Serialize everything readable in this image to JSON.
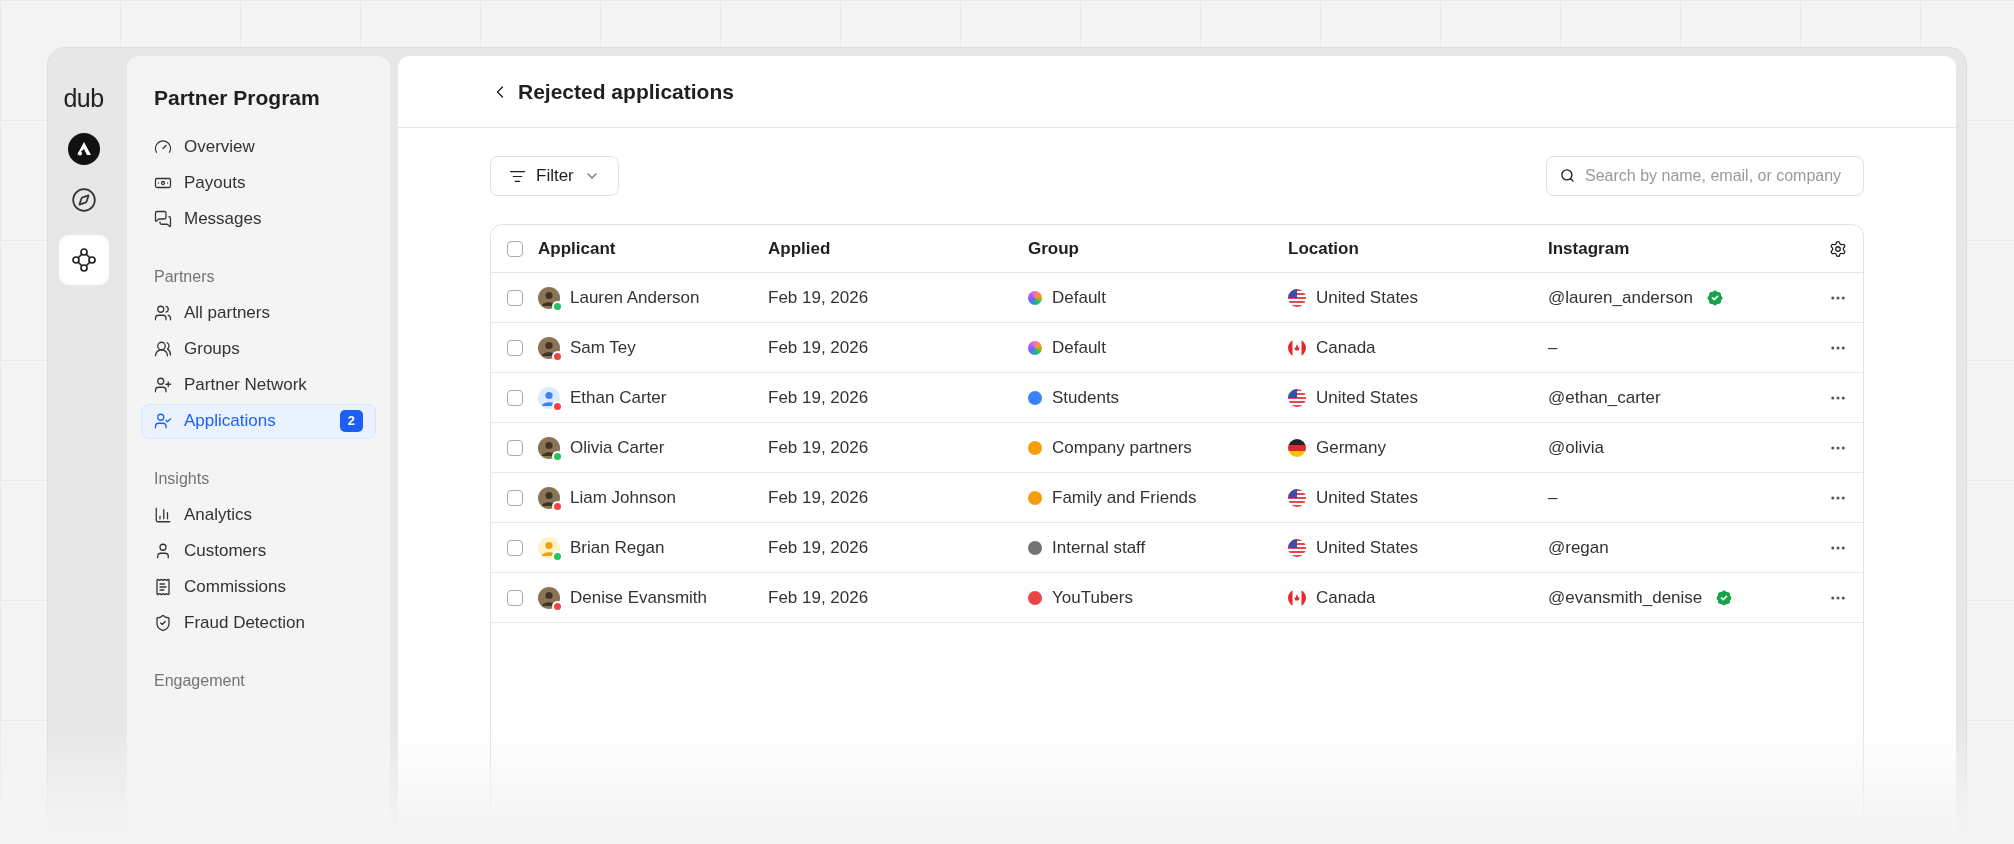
{
  "brand": "dub",
  "sidebar": {
    "title": "Partner Program",
    "sections": [
      {
        "items": [
          {
            "label": "Overview",
            "selected": false
          },
          {
            "label": "Payouts",
            "selected": false
          },
          {
            "label": "Messages",
            "selected": false
          }
        ]
      },
      {
        "heading": "Partners",
        "items": [
          {
            "label": "All partners",
            "selected": false
          },
          {
            "label": "Groups",
            "selected": false
          },
          {
            "label": "Partner Network",
            "selected": false
          },
          {
            "label": "Applications",
            "selected": true,
            "badge": "2"
          }
        ]
      },
      {
        "heading": "Insights",
        "items": [
          {
            "label": "Analytics",
            "selected": false
          },
          {
            "label": "Customers",
            "selected": false
          },
          {
            "label": "Commissions",
            "selected": false
          },
          {
            "label": "Fraud Detection",
            "selected": false
          }
        ]
      },
      {
        "heading": "Engagement"
      }
    ]
  },
  "page": {
    "title": "Rejected applications"
  },
  "filter": {
    "label": "Filter"
  },
  "search": {
    "placeholder": "Search by name, email, or company"
  },
  "table": {
    "all_checked": false,
    "columns": [
      "Applicant",
      "Applied",
      "Group",
      "Location",
      "Instagram"
    ],
    "rows": [
      {
        "checked": false,
        "name": "Lauren Anderson",
        "avatar": {
          "kind": "photo",
          "color": "#22c55e"
        },
        "applied": "Feb 19, 2026",
        "group": {
          "name": "Default",
          "kind": "gradient"
        },
        "location": {
          "name": "United States",
          "kind": "us"
        },
        "instagram": "@lauren_anderson",
        "verified": true
      },
      {
        "checked": false,
        "name": "Sam Tey",
        "avatar": {
          "kind": "photo",
          "color": "#ef4444"
        },
        "applied": "Feb 19, 2026",
        "group": {
          "name": "Default",
          "kind": "gradient"
        },
        "location": {
          "name": "Canada",
          "kind": "ca"
        },
        "instagram": "–",
        "verified": false
      },
      {
        "checked": false,
        "name": "Ethan Carter",
        "avatar": {
          "kind": "blue",
          "color": "#ef4444"
        },
        "applied": "Feb 19, 2026",
        "group": {
          "name": "Students",
          "kind": "solid",
          "color": "#3b82f6"
        },
        "location": {
          "name": "United States",
          "kind": "us"
        },
        "instagram": "@ethan_carter",
        "verified": false
      },
      {
        "checked": false,
        "name": "Olivia Carter",
        "avatar": {
          "kind": "photo",
          "color": "#22c55e"
        },
        "applied": "Feb 19, 2026",
        "group": {
          "name": "Company partners",
          "kind": "solid",
          "color": "#f59e0b"
        },
        "location": {
          "name": "Germany",
          "kind": "de"
        },
        "instagram": "@olivia",
        "verified": false
      },
      {
        "checked": false,
        "name": "Liam Johnson",
        "avatar": {
          "kind": "photo",
          "color": "#ef4444"
        },
        "applied": "Feb 19, 2026",
        "group": {
          "name": "Family and Friends",
          "kind": "solid",
          "color": "#f59e0b"
        },
        "location": {
          "name": "United States",
          "kind": "us"
        },
        "instagram": "–",
        "verified": false
      },
      {
        "checked": false,
        "name": "Brian Regan",
        "avatar": {
          "kind": "yellow",
          "color": "#22c55e"
        },
        "applied": "Feb 19, 2026",
        "group": {
          "name": "Internal staff",
          "kind": "solid",
          "color": "#737373"
        },
        "location": {
          "name": "United States",
          "kind": "us"
        },
        "instagram": "@regan",
        "verified": false
      },
      {
        "checked": false,
        "name": "Denise Evansmith",
        "avatar": {
          "kind": "photo",
          "color": "#ef4444"
        },
        "applied": "Feb 19, 2026",
        "group": {
          "name": "YouTubers",
          "kind": "solid",
          "color": "#ef4444"
        },
        "location": {
          "name": "Canada",
          "kind": "ca"
        },
        "instagram": "@evansmith_denise",
        "verified": true
      }
    ]
  }
}
